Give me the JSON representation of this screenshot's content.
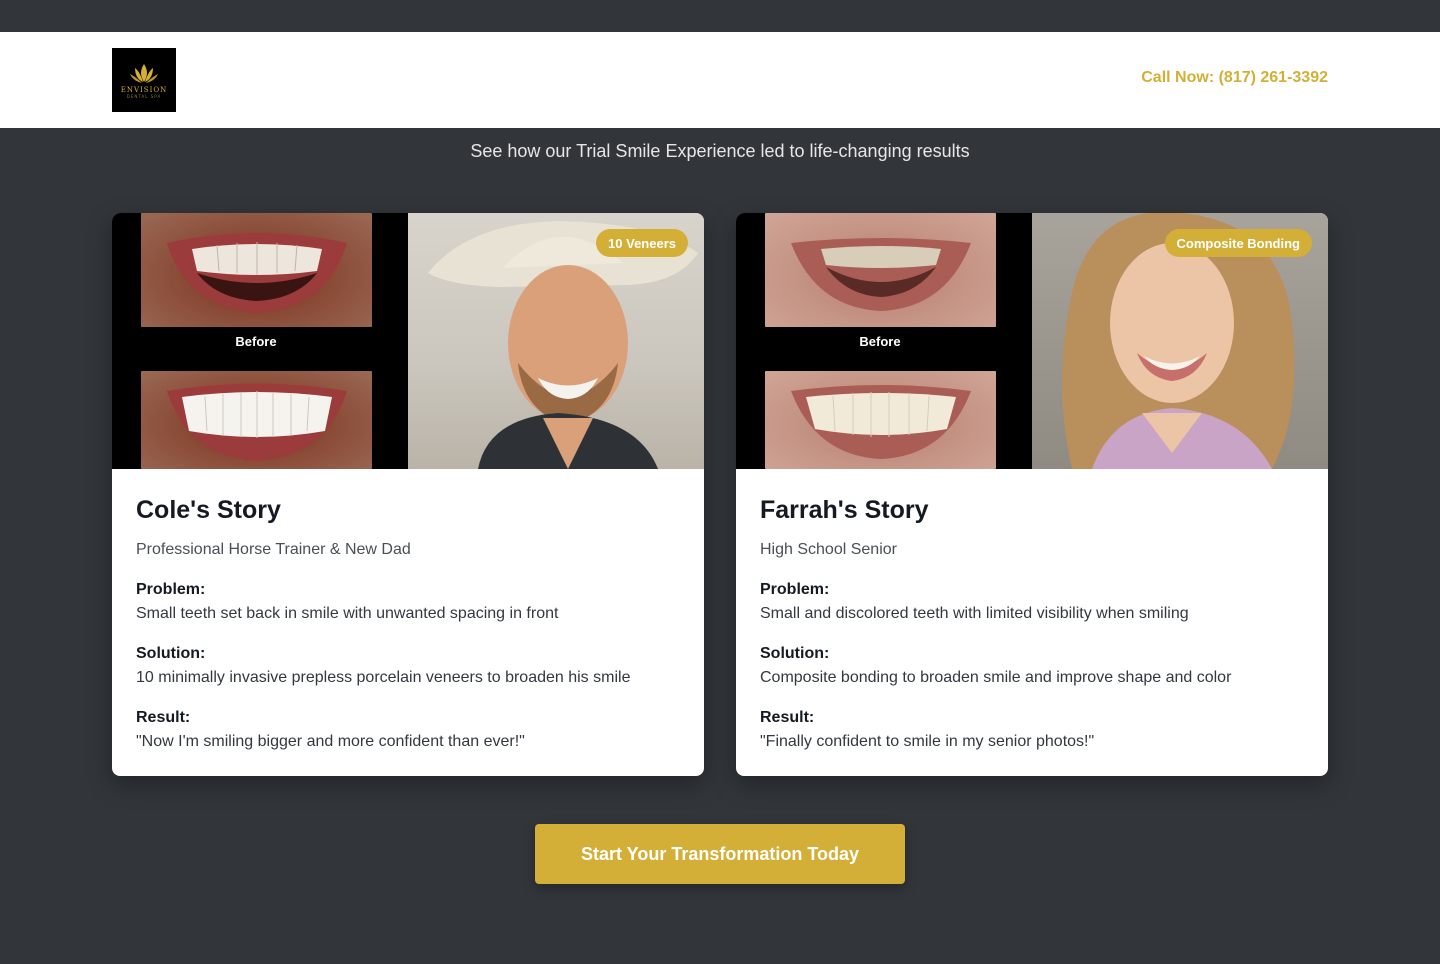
{
  "header": {
    "logo_text": "ENVISION",
    "logo_subtext": "DENTAL SPA",
    "call_label": "Call Now: (817) 261-3392"
  },
  "subtitle": "See how our Trial Smile Experience led to life-changing results",
  "stories": [
    {
      "badge": "10 Veneers",
      "before_label": "Before",
      "title": "Cole's Story",
      "subtitle": "Professional Horse Trainer & New Dad",
      "problem_label": "Problem:",
      "problem": "Small teeth set back in smile with unwanted spacing in front",
      "solution_label": "Solution:",
      "solution": "10 minimally invasive prepless porcelain veneers to broaden his smile",
      "result_label": "Result:",
      "result": "\"Now I'm smiling bigger and more confident than ever!\""
    },
    {
      "badge": "Composite Bonding",
      "before_label": "Before",
      "title": "Farrah's Story",
      "subtitle": "High School Senior",
      "problem_label": "Problem:",
      "problem": "Small and discolored teeth with limited visibility when smiling",
      "solution_label": "Solution:",
      "solution": "Composite bonding to broaden smile and improve shape and color",
      "result_label": "Result:",
      "result": "\"Finally confident to smile in my senior photos!\""
    }
  ],
  "cta_label": "Start Your Transformation Today",
  "colors": {
    "accent": "#d4af37",
    "background": "#32363b",
    "card": "#ffffff"
  }
}
